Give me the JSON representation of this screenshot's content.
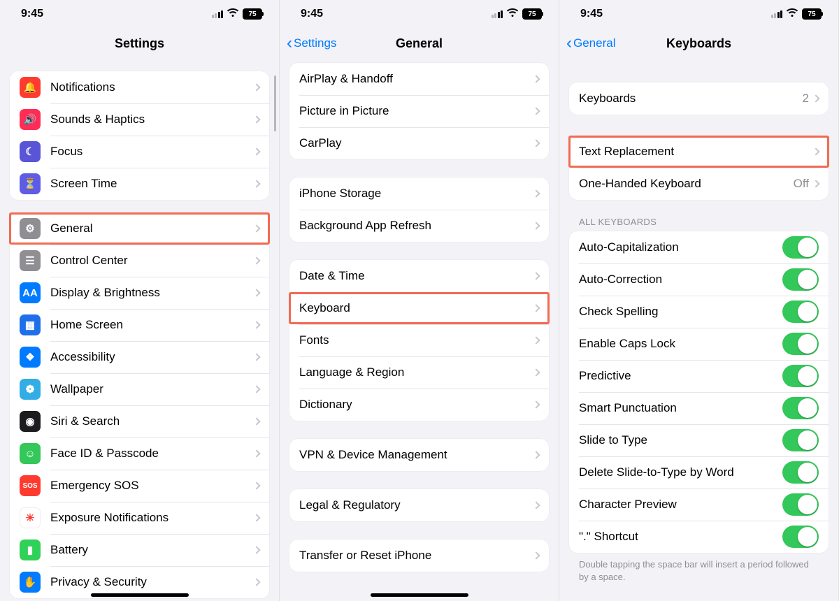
{
  "status": {
    "time": "9:45",
    "battery": "75"
  },
  "pane1": {
    "title": "Settings",
    "groups": [
      [
        {
          "icon": "bell-icon",
          "color": "c-red",
          "glyph": "🔔",
          "label": "Notifications"
        },
        {
          "icon": "speaker-icon",
          "color": "c-red2",
          "glyph": "🔊",
          "label": "Sounds & Haptics"
        },
        {
          "icon": "moon-icon",
          "color": "c-purple",
          "glyph": "☾",
          "label": "Focus"
        },
        {
          "icon": "hourglass-icon",
          "color": "c-indigo",
          "glyph": "⏳",
          "label": "Screen Time"
        }
      ],
      [
        {
          "icon": "gear-icon",
          "color": "c-gray",
          "glyph": "⚙",
          "label": "General",
          "highlight": true
        },
        {
          "icon": "switches-icon",
          "color": "c-gray",
          "glyph": "☰",
          "label": "Control Center"
        },
        {
          "icon": "aa-icon",
          "color": "c-blue",
          "glyph": "AA",
          "label": "Display & Brightness"
        },
        {
          "icon": "grid-icon",
          "color": "c-darkblue",
          "glyph": "▦",
          "label": "Home Screen"
        },
        {
          "icon": "accessibility-icon",
          "color": "c-blue",
          "glyph": "❖",
          "label": "Accessibility"
        },
        {
          "icon": "wallpaper-icon",
          "color": "c-cyan",
          "glyph": "❁",
          "label": "Wallpaper"
        },
        {
          "icon": "siri-icon",
          "color": "c-black",
          "glyph": "◉",
          "label": "Siri & Search"
        },
        {
          "icon": "faceid-icon",
          "color": "c-green",
          "glyph": "☺",
          "label": "Face ID & Passcode"
        },
        {
          "icon": "sos-icon",
          "color": "c-sos",
          "glyph": "SOS",
          "label": "Emergency SOS"
        },
        {
          "icon": "exposure-icon",
          "color": "c-white",
          "glyph": "☀",
          "label": "Exposure Notifications"
        },
        {
          "icon": "battery-icon",
          "color": "c-green2",
          "glyph": "▮",
          "label": "Battery"
        },
        {
          "icon": "hand-icon",
          "color": "c-hand",
          "glyph": "✋",
          "label": "Privacy & Security"
        }
      ]
    ]
  },
  "pane2": {
    "back": "Settings",
    "title": "General",
    "groups": [
      [
        {
          "label": "AirPlay & Handoff"
        },
        {
          "label": "Picture in Picture"
        },
        {
          "label": "CarPlay"
        }
      ],
      [
        {
          "label": "iPhone Storage"
        },
        {
          "label": "Background App Refresh"
        }
      ],
      [
        {
          "label": "Date & Time"
        },
        {
          "label": "Keyboard",
          "highlight": true
        },
        {
          "label": "Fonts"
        },
        {
          "label": "Language & Region"
        },
        {
          "label": "Dictionary"
        }
      ],
      [
        {
          "label": "VPN & Device Management"
        }
      ],
      [
        {
          "label": "Legal & Regulatory"
        }
      ],
      [
        {
          "label": "Transfer or Reset iPhone"
        }
      ]
    ]
  },
  "pane3": {
    "back": "General",
    "title": "Keyboards",
    "group1": [
      {
        "label": "Keyboards",
        "value": "2"
      }
    ],
    "group2": [
      {
        "label": "Text Replacement",
        "highlight": true
      },
      {
        "label": "One-Handed Keyboard",
        "value": "Off"
      }
    ],
    "section_header": "All Keyboards",
    "toggles": [
      {
        "label": "Auto-Capitalization"
      },
      {
        "label": "Auto-Correction"
      },
      {
        "label": "Check Spelling"
      },
      {
        "label": "Enable Caps Lock"
      },
      {
        "label": "Predictive"
      },
      {
        "label": "Smart Punctuation"
      },
      {
        "label": "Slide to Type"
      },
      {
        "label": "Delete Slide-to-Type by Word"
      },
      {
        "label": "Character Preview"
      },
      {
        "label": "\".\" Shortcut"
      }
    ],
    "footer": "Double tapping the space bar will insert a period followed by a space."
  }
}
